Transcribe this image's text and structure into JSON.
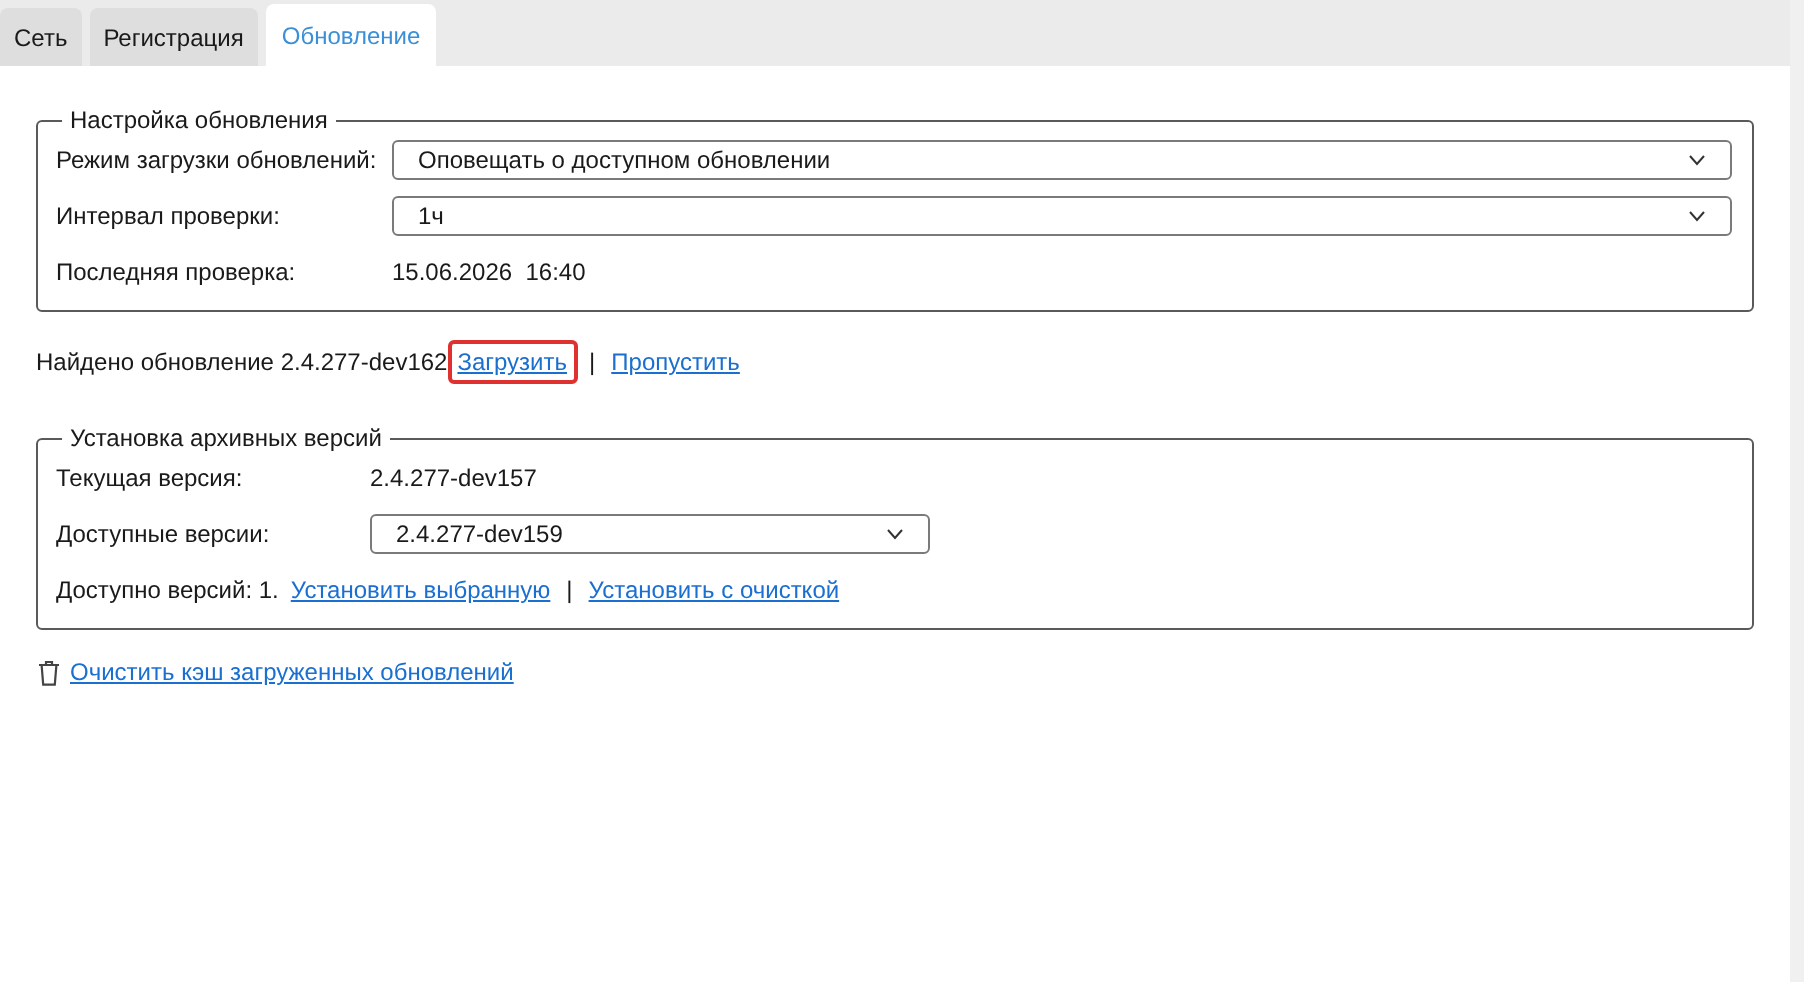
{
  "tabs": [
    {
      "label": "Сеть",
      "selected": false
    },
    {
      "label": "Регистрация",
      "selected": false
    },
    {
      "label": "Обновление",
      "selected": true
    }
  ],
  "update_settings": {
    "title": "Настройка обновления",
    "rows": [
      {
        "kind": "combo",
        "label": "Режим загрузки обновлений:",
        "value": "Оповещать о доступном обновлении"
      },
      {
        "kind": "combo",
        "label": "Интервал проверки:",
        "value": "1ч"
      },
      {
        "kind": "text",
        "label": "Последняя проверка:",
        "value": "15.06.2026  16:40"
      }
    ]
  },
  "update_found": {
    "text": "Найдено обновление 2.4.277-dev162",
    "separator": "|",
    "links": [
      {
        "label": "Загрузить",
        "highlighted": true
      },
      {
        "label": "Пропустить",
        "highlighted": false
      }
    ]
  },
  "archive": {
    "title": "Установка архивных версий",
    "rows": [
      {
        "kind": "text",
        "label": "Текущая версия:",
        "value": "2.4.277-dev157"
      },
      {
        "kind": "combo",
        "label": "Доступные версии:",
        "value": "2.4.277-dev159"
      }
    ],
    "count_text": "Доступно версий: 1.",
    "separator": "|",
    "links": [
      {
        "label": "Установить выбранную",
        "highlighted": false
      },
      {
        "label": "Установить с очисткой",
        "highlighted": false
      }
    ]
  },
  "clear_cache_link": "Очистить кэш загруженных обновлений"
}
